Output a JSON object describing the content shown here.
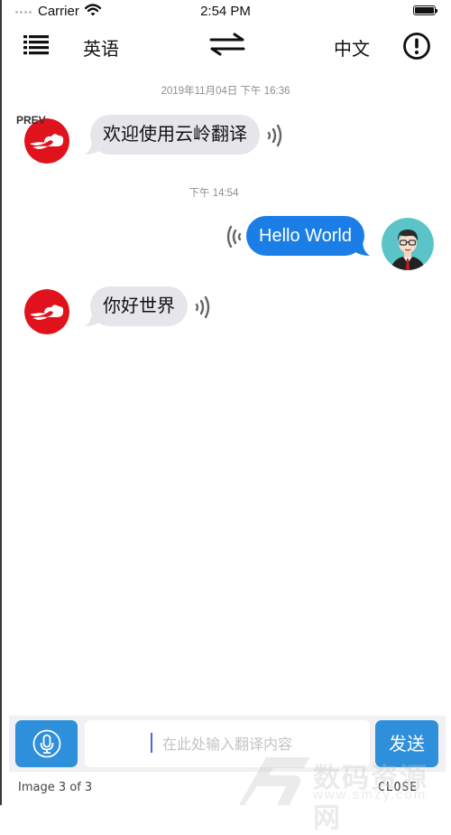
{
  "status_bar": {
    "carrier": "Carrier",
    "time": "2:54 PM",
    "battery_level": 1.0
  },
  "nav": {
    "menu_icon": "list-icon",
    "source_language": "英语",
    "swap_icon": "swap-arrows-icon",
    "target_language": "中文",
    "info_icon": "exclamation-circle-icon"
  },
  "chat": {
    "messages": [
      {
        "timestamp": "2019年11月04日 下午 16:36",
        "sender": "bot",
        "text": "欢迎使用云岭翻译",
        "avatar_icon": "cloud-logo-icon",
        "audio_icon": "speaker-wave-icon"
      },
      {
        "timestamp": "下午 14:54",
        "sender": "user",
        "text": "Hello World",
        "avatar_icon": "user-avatar-icon",
        "audio_icon": "speaker-wave-icon"
      },
      {
        "timestamp": "",
        "sender": "bot",
        "text": "你好世界",
        "avatar_icon": "cloud-logo-icon",
        "audio_icon": "speaker-wave-icon"
      }
    ]
  },
  "input_bar": {
    "mic_icon": "microphone-icon",
    "input_value": "",
    "input_placeholder": "在此处输入翻译内容",
    "send_label": "发送"
  },
  "gallery_overlay": {
    "prev_label": "PREV",
    "image_counter": "Image 3 of 3",
    "close_label": "CLOSE"
  },
  "watermark": {
    "text": "数码资源网",
    "url": "www.smzy.com"
  },
  "colors": {
    "accent_blue": "#2e8fdb",
    "outgoing_bubble": "#1a7ee6",
    "incoming_bubble": "#e5e5ea",
    "logo_red": "#e0121b",
    "avatar_bg": "#5bc4c9"
  }
}
